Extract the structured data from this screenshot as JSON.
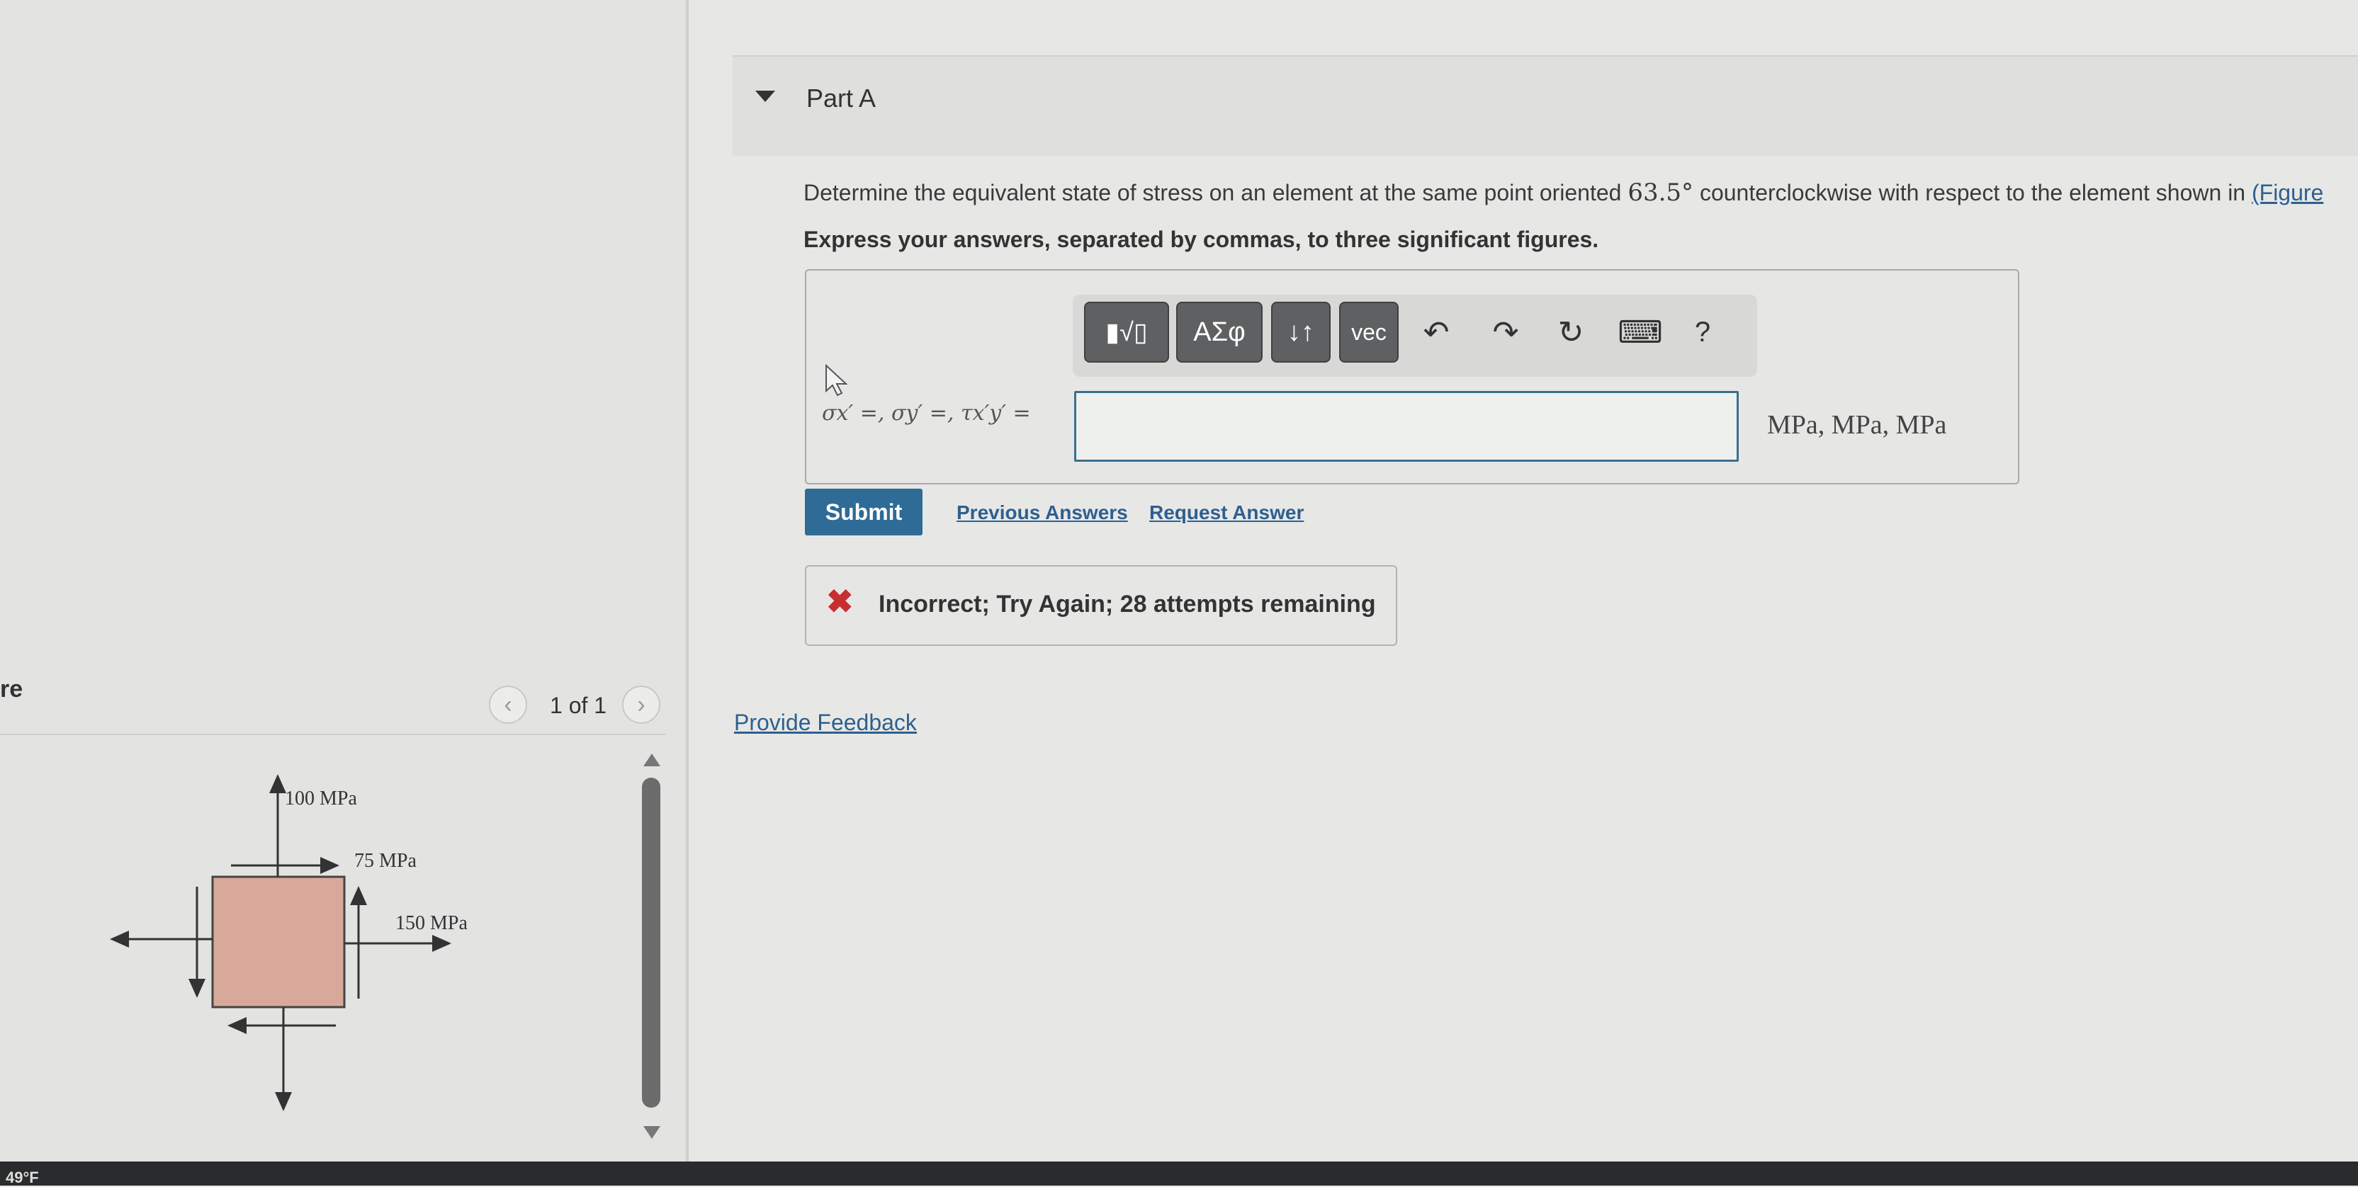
{
  "figure_panel": {
    "label": "re",
    "pager": "1 of 1",
    "prev_icon": "chevron-left-icon",
    "next_icon": "chevron-right-icon",
    "stresses": {
      "vertical": "100 MPa",
      "shear": "75 MPa",
      "horizontal": "150 MPa"
    }
  },
  "taskbar": {
    "temp": "49°F"
  },
  "part": {
    "title": "Part A"
  },
  "question": {
    "text_before": "Determine the equivalent state of stress on an element at the same point oriented",
    "angle": "63.5°",
    "text_after": "counterclockwise with respect to the element shown in",
    "figure_link": "(Figure"
  },
  "instructions": "Express your answers, separated by commas, to three significant figures.",
  "toolbar": {
    "templates_icon": "template-fraction-root-icon",
    "greek_label": "ΑΣφ",
    "arrows_label": "↓↑",
    "vec_label": "vec",
    "undo_icon": "undo-icon",
    "redo_icon": "redo-icon",
    "reset_icon": "reset-icon",
    "keyboard_icon": "keyboard-icon",
    "help_label": "?"
  },
  "answer": {
    "label": "σx′ =, σy′ =, τx′y′ =",
    "value": "",
    "units": "MPa, MPa, MPa"
  },
  "actions": {
    "submit": "Submit",
    "previous_answers": "Previous Answers",
    "request_answer": "Request Answer"
  },
  "feedback": {
    "icon": "x-icon",
    "message": "Incorrect; Try Again; 28 attempts remaining"
  },
  "provide_feedback": "Provide Feedback",
  "colors": {
    "accent": "#2e6b96",
    "error": "#c62f2f",
    "link": "#2f5f8f",
    "element_fill": "#d8a99a"
  }
}
